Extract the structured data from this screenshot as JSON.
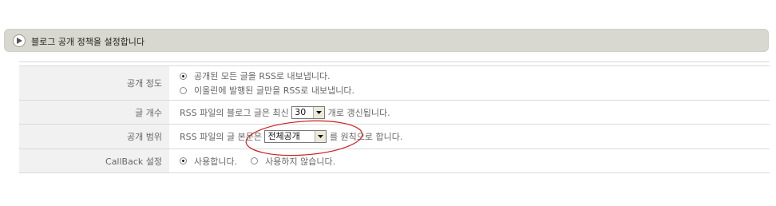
{
  "header": {
    "title": "블로그 공개 정책을 설정합니다",
    "icon": "play-arrow-icon"
  },
  "settings": {
    "visibility": {
      "label": "공개 정도",
      "options": [
        {
          "label": "공개된 모든 글을 RSS로 내보냅니다.",
          "checked": true
        },
        {
          "label": "이올린에 발행된 글만을 RSS로 내보냅니다.",
          "checked": false
        }
      ]
    },
    "post_count": {
      "label": "글 개수",
      "prefix": "RSS 파일의 블로그 글은 최신",
      "selected": "30",
      "suffix": "개로 갱신됩니다."
    },
    "scope": {
      "label": "공개 범위",
      "prefix": "RSS 파일의 글 본문은",
      "selected": "전체공개",
      "suffix": "를 원칙으로 합니다."
    },
    "callback": {
      "label": "CallBack 설정",
      "options": [
        {
          "label": "사용합니다.",
          "checked": true
        },
        {
          "label": "사용하지 않습니다.",
          "checked": false
        }
      ]
    }
  },
  "annotation": {
    "shape": "ellipse",
    "color": "#cc2020"
  }
}
